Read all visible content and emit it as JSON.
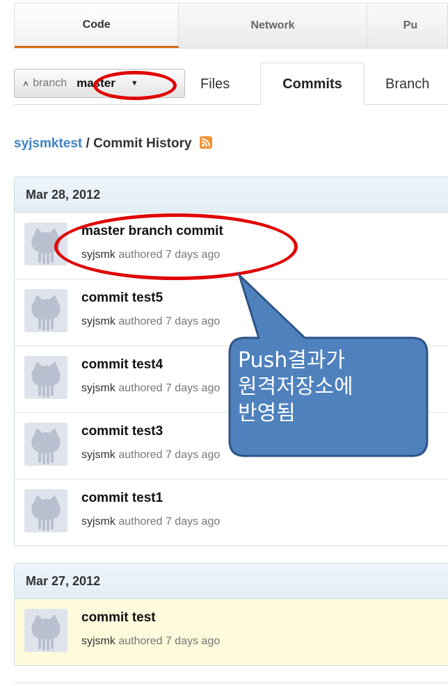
{
  "repo_nav": {
    "code": "Code",
    "network": "Network",
    "pulls": "Pu"
  },
  "subnav": {
    "branch_prefix": "branch",
    "branch_name": "master",
    "files": "Files",
    "commits": "Commits",
    "branches": "Branch"
  },
  "breadcrumb": {
    "repo": "syjsmktest",
    "separator": "/",
    "title": "Commit History"
  },
  "groups": [
    {
      "date": "Mar 28, 2012",
      "commits": [
        {
          "message": "master branch commit",
          "author": "syjsmk",
          "meta": "authored 7 days ago"
        },
        {
          "message": "commit test5",
          "author": "syjsmk",
          "meta": "authored 7 days ago"
        },
        {
          "message": "commit test4",
          "author": "syjsmk",
          "meta": "authored 7 days ago"
        },
        {
          "message": "commit test3",
          "author": "syjsmk",
          "meta": "authored 7 days ago"
        },
        {
          "message": "commit test1",
          "author": "syjsmk",
          "meta": "authored 7 days ago"
        }
      ]
    },
    {
      "date": "Mar 27, 2012",
      "commits": [
        {
          "message": "commit test",
          "author": "syjsmk",
          "meta": "authored 7 days ago"
        }
      ]
    }
  ],
  "callout": {
    "line1": "Push결과가",
    "line2": "원격저장소에",
    "line3": "반영됨"
  },
  "colors": {
    "accent": "#d26911",
    "link": "#4183c4",
    "annotation_red": "#e00000",
    "callout_blue": "#4f81bd"
  }
}
